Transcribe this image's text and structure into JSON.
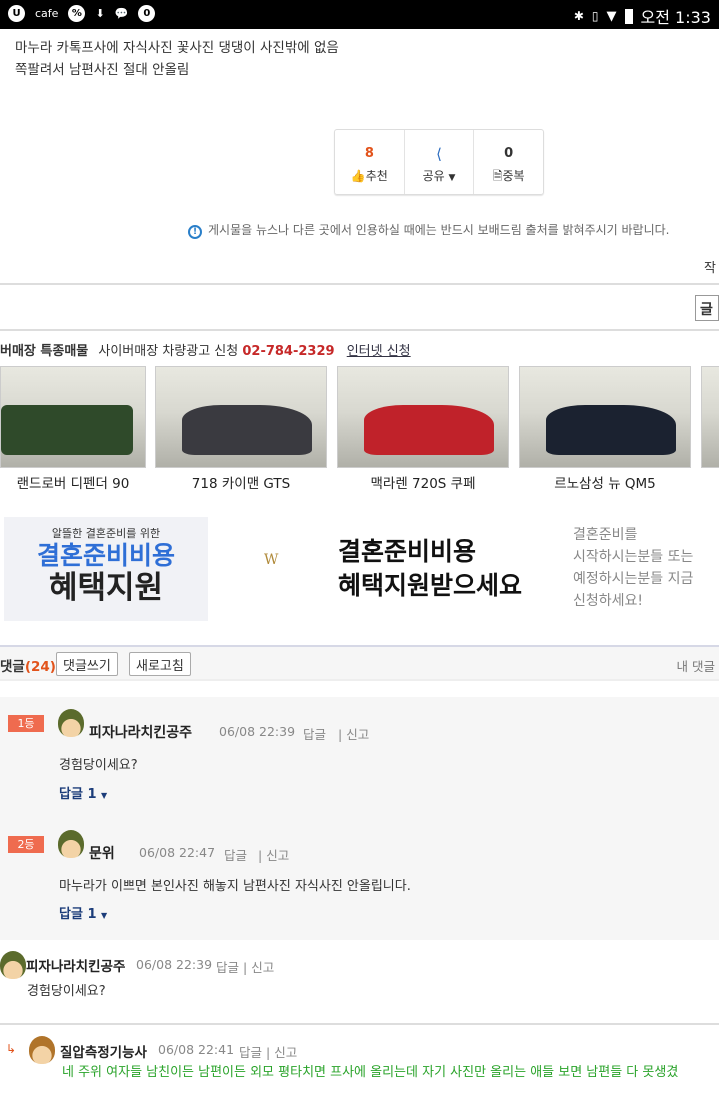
{
  "status_bar": {
    "left_icons": [
      "u-icon",
      "cafe",
      "percent-icon",
      "download-icon",
      "chat-icon",
      "notification-icon"
    ],
    "cafe_label": "cafe",
    "time": "오전 1:33"
  },
  "post": {
    "lines": [
      "마누라 카톡프사에 자식사진 꽃사진 댕댕이 사진밖에 없음",
      "쪽팔려서 남편사진 절대 안올림"
    ]
  },
  "actions": {
    "recommend_count": "8",
    "recommend_label": "추천",
    "share_label": "공유",
    "duplicate_count": "0",
    "duplicate_label": "중복"
  },
  "notice": "게시물을 뉴스나 다른 곳에서 인용하실 때에는 반드시 보배드림 출처를 밝혀주시기 바랍니다.",
  "partial_right_text": "작",
  "partial_button": "글",
  "ad_cars": {
    "title": "버매장 특종매물",
    "subtitle": "사이버매장 차량광고 신청",
    "phone": "02-784-2329",
    "link": "인터넷 신청",
    "items": [
      {
        "name": "랜드로버 디펜더 90",
        "color": "#2f4a2a"
      },
      {
        "name": "718 카이맨 GTS",
        "color": "#3a3a40"
      },
      {
        "name": "맥라렌 720S 쿠페",
        "color": "#c0222a"
      },
      {
        "name": "르노삼성 뉴 QM5",
        "color": "#1b2230"
      }
    ]
  },
  "banner": {
    "small": "알뜰한 결혼준비를 위한",
    "big1": "결혼준비비용",
    "big2": "혜택지원",
    "logo": "W",
    "main1": "결혼준비비용",
    "main2": "혜택지원받으세요",
    "side": [
      "결혼준비를",
      "시작하시는분들 또는",
      "예정하시는분들 지금",
      "신청하세요!"
    ]
  },
  "comments_header": {
    "label": "댓글",
    "count": "(24)",
    "write": "댓글쓰기",
    "refresh": "새로고침",
    "my": "내 댓글"
  },
  "best_comments": [
    {
      "rank": "1등",
      "nick": "피자나라치킨공주",
      "date": "06/08 22:39",
      "reply": "답글",
      "report": "신고",
      "text": "경험당이세요?",
      "replies": "답글 1"
    },
    {
      "rank": "2등",
      "nick": "문위",
      "date": "06/08 22:47",
      "reply": "답글",
      "report": "신고",
      "text": "마누라가 이쁘면 본인사진 해놓지 남편사진 자식사진 안올립니다.",
      "replies": "답글 1"
    }
  ],
  "comments": [
    {
      "nick": "피자나라치킨공주",
      "date": "06/08 22:39",
      "reply": "답글",
      "report": "신고",
      "text": "경험당이세요?"
    },
    {
      "nick": "질압측정기능사",
      "date": "06/08 22:41",
      "reply": "답글",
      "report": "신고",
      "text": "네 주위 여자들 남친이든 남편이든 외모 평타치면 프사에 올리는데 자기 사진만 올리는 애들 보면 남편들 다 못생겼"
    }
  ]
}
